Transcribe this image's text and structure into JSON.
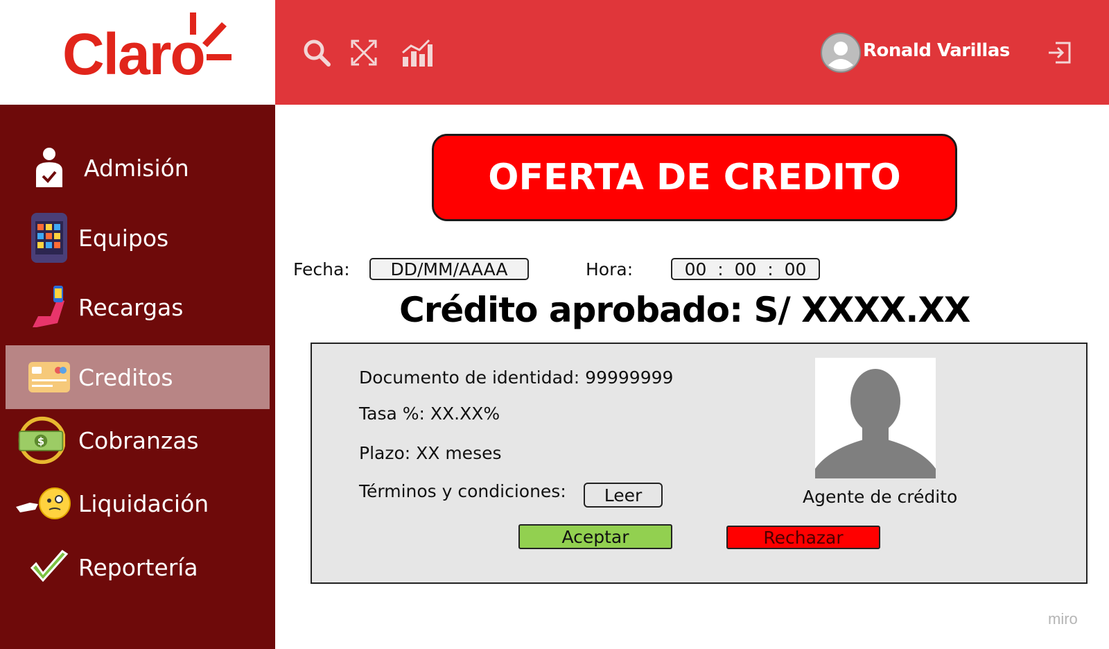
{
  "brand": {
    "name": "Claro",
    "color": "#e1251b"
  },
  "topbar": {
    "color": "#e0363a",
    "icons": [
      "search-icon",
      "expand-arrows-icon",
      "analytics-chart-icon"
    ],
    "user_name": "Ronald Varillas",
    "logout_icon": "logout-icon"
  },
  "sidebar": {
    "color": "#6e0a0a",
    "active_color": "#b88585",
    "items": [
      {
        "label": "Admisión",
        "icon": "person-check-icon"
      },
      {
        "label": "Equipos",
        "icon": "phone-apps-icon"
      },
      {
        "label": "Recargas",
        "icon": "hand-phone-icon"
      },
      {
        "label": "Creditos",
        "icon": "credit-card-icon",
        "active": true
      },
      {
        "label": "Cobranzas",
        "icon": "money-icon"
      },
      {
        "label": "Liquidación",
        "icon": "face-pointing-icon"
      },
      {
        "label": "Reportería",
        "icon": "checkmark-icon"
      }
    ]
  },
  "main": {
    "banner_title": "OFERTA DE CREDITO",
    "fecha_label": "Fecha:",
    "fecha_value": "DD/MM/AAAA",
    "hora_label": "Hora:",
    "hora_value": "00  :  00  :  00",
    "approved_text": "Crédito aprobado: S/ XXXX.XX",
    "panel": {
      "documento": "Documento de identidad: 99999999",
      "tasa": "Tasa %: XX.XX%",
      "plazo": "Plazo: XX meses",
      "terminos": "Términos y condiciones:",
      "leer_label": "Leer",
      "agent_label": "Agente de crédito",
      "accept_label": "Aceptar",
      "reject_label": "Rechazar"
    }
  },
  "watermark": "miro"
}
